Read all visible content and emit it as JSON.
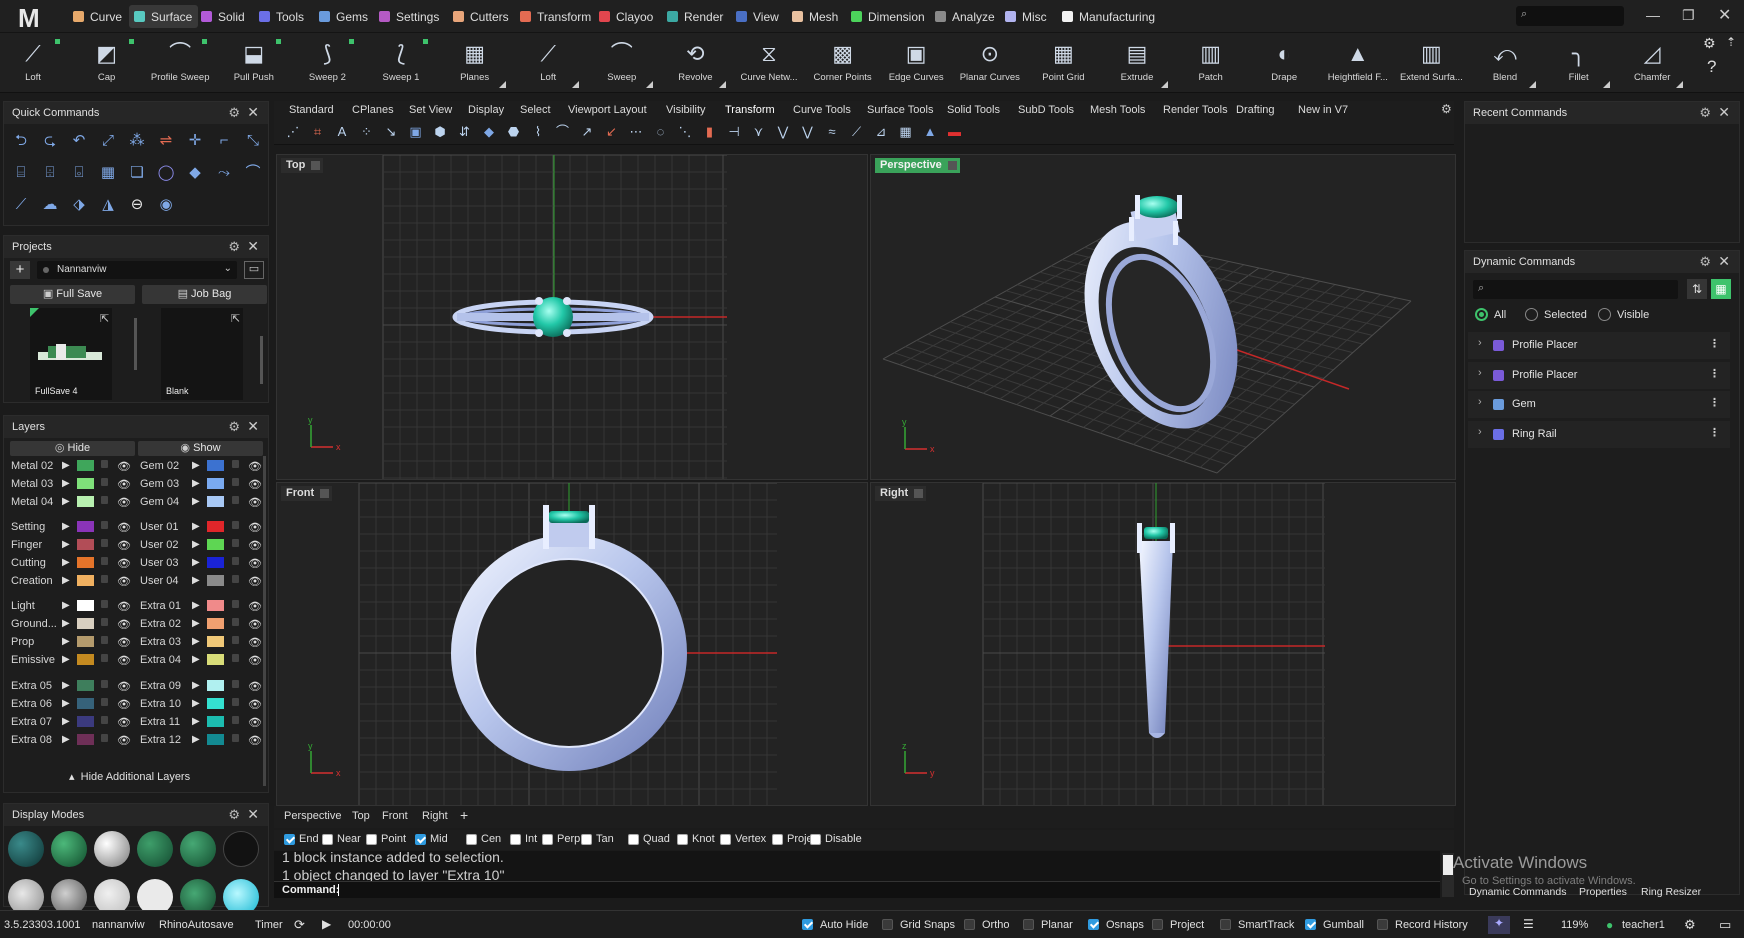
{
  "menubar": {
    "logo": "M",
    "tabs": [
      {
        "label": "Curve",
        "color": "#e7a96b"
      },
      {
        "label": "Surface",
        "color": "#58c9c0",
        "active": true
      },
      {
        "label": "Solid",
        "color": "#b25ad8"
      },
      {
        "label": "Tools",
        "color": "#6b6fe6"
      },
      {
        "label": "Gems",
        "color": "#6a9bdc"
      },
      {
        "label": "Settings",
        "color": "#b55ac4"
      },
      {
        "label": "Cutters",
        "color": "#e8a57a"
      },
      {
        "label": "Transform",
        "color": "#e36b52"
      },
      {
        "label": "Clayoo",
        "color": "#e2464e"
      },
      {
        "label": "Render",
        "color": "#3ca9a3"
      },
      {
        "label": "View",
        "color": "#4a6fc4"
      },
      {
        "label": "Mesh",
        "color": "#e9c1a0"
      },
      {
        "label": "Dimension",
        "color": "#4cd35b"
      },
      {
        "label": "Analyze",
        "color": "#8a8a8a"
      },
      {
        "label": "Misc",
        "color": "#b2b4f0"
      },
      {
        "label": "Manufacturing",
        "color": "#f2f2f2"
      }
    ],
    "search_placeholder": "⌕"
  },
  "toolbar": {
    "buttons": [
      "Loft",
      "Cap",
      "Profile Sweep",
      "Pull Push",
      "Sweep 2",
      "Sweep 1",
      "Planes",
      "Loft",
      "Sweep",
      "Revolve",
      "Curve Netw...",
      "Corner Points",
      "Edge Curves",
      "Planar Curves",
      "Point Grid",
      "Extrude",
      "Patch",
      "Drape",
      "Heightfield F...",
      "Extend Surfa...",
      "Blend",
      "Fillet",
      "Chamfer"
    ]
  },
  "quick_commands": {
    "title": "Quick Commands"
  },
  "projects": {
    "title": "Projects",
    "project_name": "Nannanviw",
    "full_save": "Full Save",
    "job_bag": "Job Bag",
    "thumbs": [
      {
        "label": "FullSave 4"
      },
      {
        "label": "Blank"
      }
    ]
  },
  "layers": {
    "title": "Layers",
    "hide": "Hide",
    "show": "Show",
    "left": [
      {
        "name": "Metal 02",
        "color": "#3fa65b"
      },
      {
        "name": "Metal 03",
        "color": "#7fe07a"
      },
      {
        "name": "Metal 04",
        "color": "#b8f0b0"
      },
      {
        "name": "Setting",
        "color": "#8a34b8"
      },
      {
        "name": "Finger",
        "color": "#b24d57"
      },
      {
        "name": "Cutting",
        "color": "#e5742a"
      },
      {
        "name": "Creation",
        "color": "#f0b060"
      },
      {
        "name": "Light",
        "color": "#ffffff"
      },
      {
        "name": "Ground...",
        "color": "#d8cfc0"
      },
      {
        "name": "Prop",
        "color": "#b49a6c"
      },
      {
        "name": "Emissive",
        "color": "#c48a20"
      },
      {
        "name": "Extra 05",
        "color": "#3e7e5c"
      },
      {
        "name": "Extra 06",
        "color": "#36627a"
      },
      {
        "name": "Extra 07",
        "color": "#3b3a7e"
      },
      {
        "name": "Extra 08",
        "color": "#6e2f57"
      }
    ],
    "right": [
      {
        "name": "Gem 02",
        "color": "#3c72d0"
      },
      {
        "name": "Gem 03",
        "color": "#7aaaf0"
      },
      {
        "name": "Gem 04",
        "color": "#a8c8f4"
      },
      {
        "name": "User 01",
        "color": "#e0262a"
      },
      {
        "name": "User 02",
        "color": "#5ed653"
      },
      {
        "name": "User 03",
        "color": "#1a23d6"
      },
      {
        "name": "User 04",
        "color": "#8a8a8a"
      },
      {
        "name": "Extra 01",
        "color": "#f08a8a"
      },
      {
        "name": "Extra 02",
        "color": "#f0a070"
      },
      {
        "name": "Extra 03",
        "color": "#f0c878"
      },
      {
        "name": "Extra 04",
        "color": "#d8dc78"
      },
      {
        "name": "Extra 09",
        "color": "#b0f0f0"
      },
      {
        "name": "Extra 10",
        "color": "#34e0d0"
      },
      {
        "name": "Extra 11",
        "color": "#1cbcb0"
      },
      {
        "name": "Extra 12",
        "color": "#138a92"
      }
    ],
    "hide_additional": "Hide Additional Layers"
  },
  "display_modes": {
    "title": "Display Modes"
  },
  "viewport_tabs": [
    "Standard",
    "CPlanes",
    "Set View",
    "Display",
    "Select",
    "Viewport Layout",
    "Visibility",
    "Transform",
    "Curve Tools",
    "Surface Tools",
    "Solid Tools",
    "SubD Tools",
    "Mesh Tools",
    "Render Tools",
    "Drafting",
    "New in V7"
  ],
  "viewports": {
    "top": "Top",
    "perspective": "Perspective",
    "front": "Front",
    "right": "Right"
  },
  "bottom_tabs": [
    "Perspective",
    "Top",
    "Front",
    "Right",
    "+"
  ],
  "osnaps": [
    {
      "label": "End",
      "on": true
    },
    {
      "label": "Near",
      "on": false
    },
    {
      "label": "Point",
      "on": false
    },
    {
      "label": "Mid",
      "on": true
    },
    {
      "label": "Cen",
      "on": false
    },
    {
      "label": "Int",
      "on": false
    },
    {
      "label": "Perp",
      "on": false
    },
    {
      "label": "Tan",
      "on": false
    },
    {
      "label": "Quad",
      "on": false
    },
    {
      "label": "Knot",
      "on": false
    },
    {
      "label": "Vertex",
      "on": false
    },
    {
      "label": "Project",
      "on": false
    },
    {
      "label": "Disable",
      "on": false
    }
  ],
  "command_history": [
    "1 block instance added to selection.",
    "1 object changed to layer \"Extra 10\""
  ],
  "command_prompt": "Command:",
  "recent_commands": {
    "title": "Recent Commands"
  },
  "dynamic_commands": {
    "title": "Dynamic Commands",
    "filters": [
      "All",
      "Selected",
      "Visible"
    ],
    "items": [
      {
        "name": "Profile Placer",
        "color": "#7a5ad8"
      },
      {
        "name": "Profile Placer",
        "color": "#7a5ad8"
      },
      {
        "name": "Gem",
        "color": "#6a9bdc"
      },
      {
        "name": "Ring Rail",
        "color": "#6b6fe6"
      }
    ]
  },
  "right_bottom_tabs": [
    "Dynamic Commands",
    "Properties",
    "Ring Resizer"
  ],
  "activate_windows": {
    "title": "Activate Windows",
    "subtitle": "Go to Settings to activate Windows."
  },
  "statusbar": {
    "version": "3.5.23303.1001",
    "user": "nannanviw",
    "autosave": "RhinoAutosave",
    "timer": "Timer",
    "time": "00:00:00",
    "toggles": [
      {
        "label": "Auto Hide",
        "on": true
      },
      {
        "label": "Grid Snaps",
        "on": false
      },
      {
        "label": "Ortho",
        "on": false
      },
      {
        "label": "Planar",
        "on": false
      },
      {
        "label": "Osnaps",
        "on": true
      },
      {
        "label": "Project",
        "on": false
      },
      {
        "label": "SmartTrack",
        "on": false
      },
      {
        "label": "Gumball",
        "on": true
      },
      {
        "label": "Record History",
        "on": false
      }
    ],
    "zoom": "119%",
    "account": "teacher1"
  }
}
